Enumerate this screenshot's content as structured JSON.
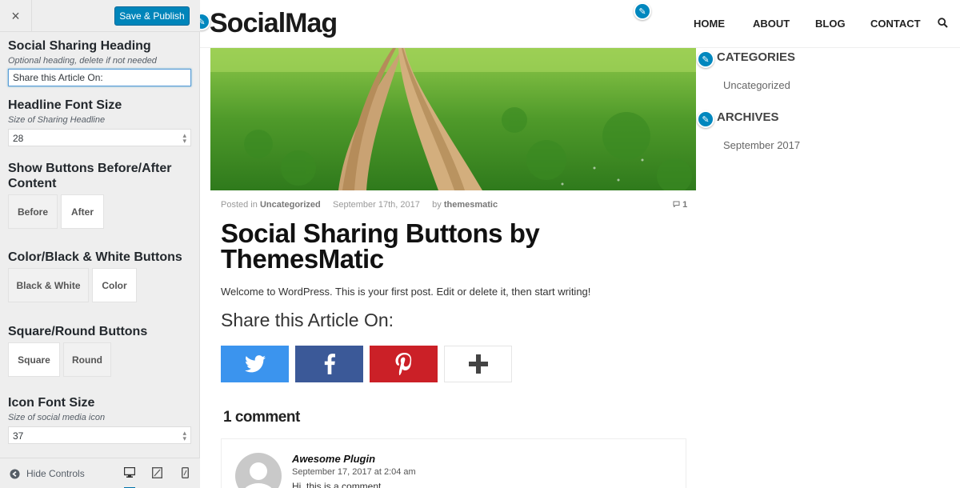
{
  "customizer": {
    "close_icon": "×",
    "publish_label": "Save & Publish",
    "heading_control": {
      "title": "Social Sharing Heading",
      "description": "Optional heading, delete if not needed",
      "value": "Share this Article On:"
    },
    "font_size_control": {
      "title": "Headline Font Size",
      "description": "Size of Sharing Headline",
      "value": "28"
    },
    "position_control": {
      "title": "Show Buttons Before/After Content",
      "options": [
        "Before",
        "After"
      ],
      "selected": "After"
    },
    "color_control": {
      "title": "Color/Black & White Buttons",
      "options": [
        "Black & White",
        "Color"
      ],
      "selected": "Color"
    },
    "shape_control": {
      "title": "Square/Round Buttons",
      "options": [
        "Square",
        "Round"
      ],
      "selected": "Square"
    },
    "icon_size_control": {
      "title": "Icon Font Size",
      "description": "Size of social media icon",
      "value": "37"
    },
    "footer": {
      "hide_controls_label": "Hide Controls",
      "devices": [
        "desktop-icon",
        "tablet-icon",
        "mobile-icon"
      ]
    }
  },
  "site": {
    "logo": "SocialMag",
    "nav": [
      "HOME",
      "ABOUT",
      "BLOG",
      "CONTACT"
    ],
    "search_icon": "search-icon"
  },
  "post": {
    "posted_in_prefix": "Posted in",
    "category": "Uncategorized",
    "date": "September 17th, 2017",
    "by_prefix": "by",
    "author": "themesmatic",
    "comment_count": "1",
    "title": "Social Sharing Buttons by ThemesMatic",
    "body": "Welcome to WordPress. This is your first post. Edit or delete it, then start writing!",
    "share_heading": "Share this Article On:",
    "share_buttons": [
      {
        "name": "twitter",
        "color": "#3b94ee"
      },
      {
        "name": "facebook",
        "color": "#3b5998"
      },
      {
        "name": "pinterest",
        "color": "#cb2027"
      },
      {
        "name": "more",
        "color": "#ffffff"
      }
    ]
  },
  "comments": {
    "title": "1 comment",
    "items": [
      {
        "author": "Awesome Plugin",
        "date": "September 17, 2017 at 2:04 am",
        "text": "Hi, this is a comment."
      }
    ]
  },
  "sidebar_widgets": {
    "categories_title": "CATEGORIES",
    "categories": [
      "Uncategorized"
    ],
    "archives_title": "ARCHIVES",
    "archives": [
      "September 2017"
    ]
  },
  "colors": {
    "accent": "#0085ba",
    "edit_pencil": "#0087be"
  }
}
